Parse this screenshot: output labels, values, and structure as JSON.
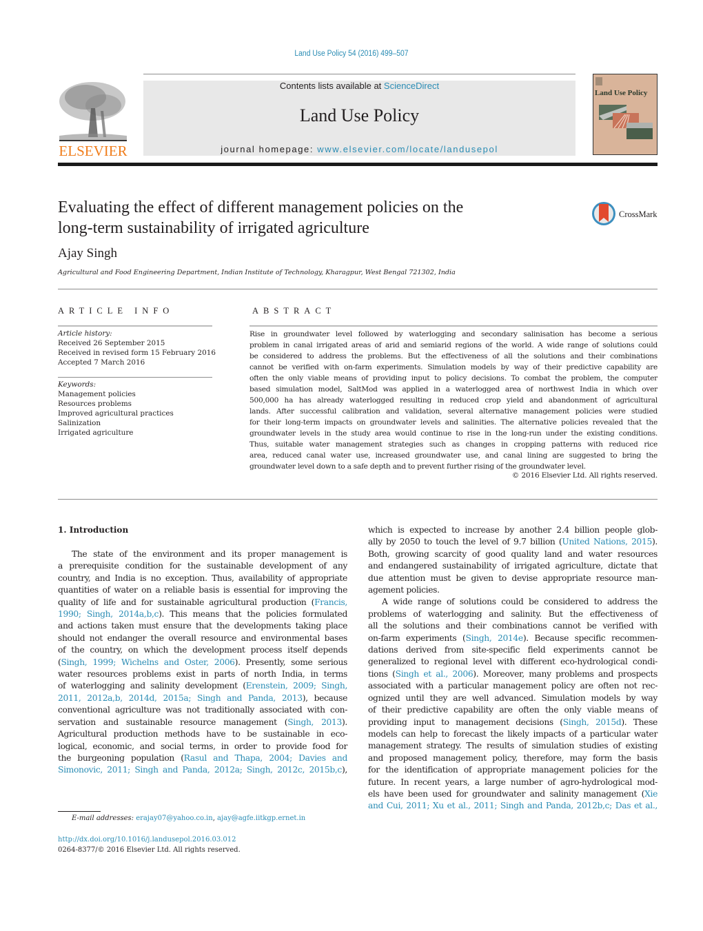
{
  "header": {
    "citation": "Land Use Policy 54 (2016) 499–507",
    "contents_prefix": "Contents lists available at ",
    "contents_link": "ScienceDirect",
    "journal_title": "Land Use Policy",
    "homepage_prefix": "journal homepage: ",
    "homepage_link": "www.elsevier.com/locate/landusepol",
    "publisher": "ELSEVIER",
    "cover_title": "Land Use Policy",
    "colors": {
      "link": "#2a8cb4",
      "publisher": "#f07d1b",
      "cover": "#d9b49a"
    }
  },
  "article": {
    "title_lines": [
      "Evaluating the effect of different management policies on the",
      "long-term sustainability of irrigated agriculture"
    ],
    "crossmark_label": "CrossMark",
    "author": "Ajay Singh",
    "affiliation": "Agricultural and Food Engineering Department, Indian Institute of Technology, Kharagpur, West Bengal 721302, India"
  },
  "article_info": {
    "heading": "ARTICLE INFO",
    "history_label": "Article history:",
    "history": [
      "Received 26 September 2015",
      "Received in revised form 15 February 2016",
      "Accepted 7 March 2016"
    ],
    "keywords_label": "Keywords:",
    "keywords": [
      "Management policies",
      "Resources problems",
      "Improved agricultural practices",
      "Salinization",
      "Irrigated agriculture"
    ]
  },
  "abstract": {
    "heading": "ABSTRACT",
    "lines": [
      "Rise in groundwater level followed by waterlogging and secondary salinisation has become a serious",
      "problem in canal irrigated areas of arid and semiarid regions of the world. A wide range of solutions could",
      "be considered to address the problems. But the effectiveness of all the solutions and their combinations",
      "cannot be verified with on-farm experiments. Simulation models by way of their predictive capability are",
      "often the only viable means of providing input to policy decisions. To combat the problem, the computer",
      "based simulation model, SaltMod was applied in a waterlogged area of northwest India in which over",
      "500,000 ha has already waterlogged resulting in reduced crop yield and abandonment of agricultural",
      "lands. After successful calibration and validation, several alternative management policies were studied",
      "for their long-term impacts on groundwater levels and salinities. The alternative policies revealed that the",
      "groundwater levels in the study area would continue to rise in the long-run under the existing conditions.",
      "Thus, suitable water management strategies such as changes in cropping patterns with reduced rice",
      "area, reduced canal water use, increased groundwater use, and canal lining are suggested to bring the",
      "groundwater level down to a safe depth and to prevent further rising of the groundwater level."
    ],
    "copyright": "© 2016 Elsevier Ltd. All rights reserved."
  },
  "introduction": {
    "heading": "1.  Introduction",
    "left_lines": [
      [
        {
          "t": "The state of the environment and its proper management is"
        }
      ],
      [
        {
          "t": "a prerequisite condition for the sustainable development of any"
        }
      ],
      [
        {
          "t": "country, and India is no exception. Thus, availability of appropriate"
        }
      ],
      [
        {
          "t": "quantities of water on a reliable basis is essential for improving the"
        }
      ],
      [
        {
          "t": "quality of life and for sustainable agricultural production ("
        },
        {
          "t": "Francis,",
          "l": 1
        }
      ],
      [
        {
          "t": "1990; Singh, 2014a,b,c",
          "l": 1
        },
        {
          "t": "). This means that the policies formulated"
        }
      ],
      [
        {
          "t": "and actions taken must ensure that the developments taking place"
        }
      ],
      [
        {
          "t": "should not endanger the overall resource and environmental bases"
        }
      ],
      [
        {
          "t": "of the country, on which the development process itself depends"
        }
      ],
      [
        {
          "t": "("
        },
        {
          "t": "Singh, 1999; Wichelns and Oster, 2006",
          "l": 1
        },
        {
          "t": "). Presently, some serious"
        }
      ],
      [
        {
          "t": "water resources problems exist in parts of north India, in terms"
        }
      ],
      [
        {
          "t": "of waterlogging and salinity development ("
        },
        {
          "t": "Erenstein, 2009; Singh,",
          "l": 1
        }
      ],
      [
        {
          "t": "2011, 2012a,b, 2014d, 2015a; Singh and Panda, 2013",
          "l": 1
        },
        {
          "t": "), because"
        }
      ],
      [
        {
          "t": "conventional agriculture was not traditionally associated with con-"
        }
      ],
      [
        {
          "t": "servation and sustainable resource management ("
        },
        {
          "t": "Singh, 2013",
          "l": 1
        },
        {
          "t": ")."
        }
      ],
      [
        {
          "t": "Agricultural production methods have to be sustainable in eco-"
        }
      ],
      [
        {
          "t": "logical, economic, and social terms, in order to provide food for"
        }
      ],
      [
        {
          "t": "the burgeoning population ("
        },
        {
          "t": "Rasul and Thapa, 2004; Davies and",
          "l": 1
        }
      ],
      [
        {
          "t": "Simonovic, 2011; Singh and Panda, 2012a; Singh, 2012c, 2015b,c",
          "l": 1
        },
        {
          "t": "),"
        }
      ]
    ],
    "right_lines": [
      [
        {
          "t": "which is expected to increase by another 2.4 billion people glob-"
        }
      ],
      [
        {
          "t": "ally by 2050 to touch the level of 9.7 billion ("
        },
        {
          "t": "United Nations, 2015",
          "l": 1
        },
        {
          "t": ")."
        }
      ],
      [
        {
          "t": "Both, growing scarcity of good quality land and water resources"
        }
      ],
      [
        {
          "t": "and endangered sustainability of irrigated agriculture, dictate that"
        }
      ],
      [
        {
          "t": "due attention must be given to devise appropriate resource man-"
        }
      ],
      [
        {
          "t": "agement policies."
        }
      ],
      [
        {
          "t": "A wide range of solutions could be considered to address the"
        }
      ],
      [
        {
          "t": "problems of waterlogging and salinity. But the effectiveness of"
        }
      ],
      [
        {
          "t": "all the solutions and their combinations cannot be verified with"
        }
      ],
      [
        {
          "t": "on-farm experiments ("
        },
        {
          "t": "Singh, 2014e",
          "l": 1
        },
        {
          "t": "). Because specific recommen-"
        }
      ],
      [
        {
          "t": "dations derived from site-specific field experiments cannot be"
        }
      ],
      [
        {
          "t": "generalized to regional level with different eco-hydrological condi-"
        }
      ],
      [
        {
          "t": "tions ("
        },
        {
          "t": "Singh et al., 2006",
          "l": 1
        },
        {
          "t": "). Moreover, many problems and prospects"
        }
      ],
      [
        {
          "t": "associated with a particular management policy are often not rec-"
        }
      ],
      [
        {
          "t": "ognized until they are well advanced. Simulation models by way"
        }
      ],
      [
        {
          "t": "of their predictive capability are often the only viable means of"
        }
      ],
      [
        {
          "t": "providing input to management decisions ("
        },
        {
          "t": "Singh, 2015d",
          "l": 1
        },
        {
          "t": "). These"
        }
      ],
      [
        {
          "t": "models can help to forecast the likely impacts of a particular water"
        }
      ],
      [
        {
          "t": "management strategy. The results of simulation studies of existing"
        }
      ],
      [
        {
          "t": "and proposed management policy, therefore, may form the basis"
        }
      ],
      [
        {
          "t": "for the identification of appropriate management policies for the"
        }
      ],
      [
        {
          "t": "future. In recent years, a large number of agro-hydrological mod-"
        }
      ],
      [
        {
          "t": "els have been used for groundwater and salinity management ("
        },
        {
          "t": "Xie",
          "l": 1
        }
      ],
      [
        {
          "t": "and Cui, 2011; Xu et al., 2011; Singh and Panda, 2012b,c; Das et al.,",
          "l": 1
        }
      ]
    ],
    "left_indent_lines": [
      0
    ],
    "left_last_lines": [],
    "right_indent_lines": [
      6
    ],
    "right_last_lines": [
      5
    ]
  },
  "footer": {
    "email_label": "E-mail addresses:",
    "emails": [
      "erajay07@yahoo.co.in",
      "ajay@agfe.iitkgp.ernet.in"
    ],
    "doi": "http://dx.doi.org/10.1016/j.landusepol.2016.03.012",
    "issn": "0264-8377/© 2016 Elsevier Ltd. All rights reserved."
  }
}
